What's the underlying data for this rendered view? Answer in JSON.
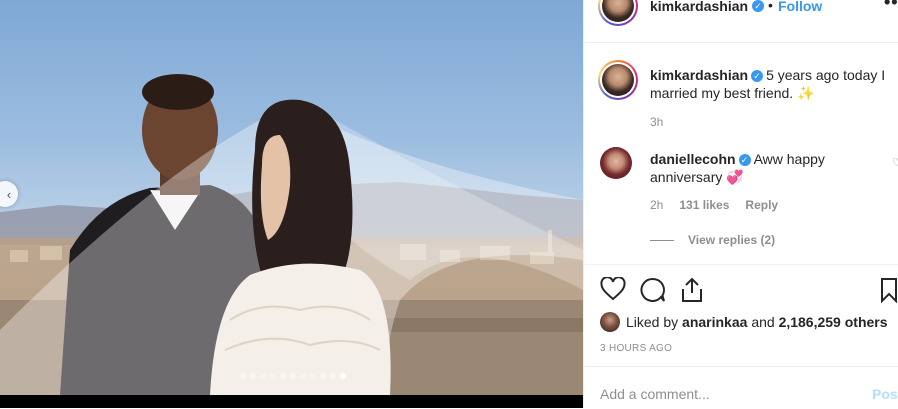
{
  "header": {
    "username": "kimkardashian",
    "separator": "•",
    "follow_label": "Follow",
    "more_label": "••"
  },
  "caption": {
    "username": "kimkardashian",
    "text": "5 years ago today I married my best friend.",
    "emoji": "✨",
    "time": "3h"
  },
  "comment": {
    "username": "daniellecohn",
    "text": "Aww happy anniversary",
    "emoji": "💞",
    "time": "2h",
    "likes": "131 likes",
    "reply_label": "Reply",
    "heart_icon": "heart-outline-icon",
    "heart_glyph": "♡"
  },
  "view_replies": "View replies (2)",
  "likes": {
    "prefix": "Liked by",
    "user": "anarinkaa",
    "and": "and",
    "count": "2,186,259 others"
  },
  "time_ago": "3 HOURS AGO",
  "add_comment": {
    "placeholder": "Add a comment...",
    "post_label": "Post"
  },
  "carousel": {
    "prev_glyph": "‹",
    "dot_count": 11,
    "active_index": 10
  },
  "colors": {
    "accent": "#3897f0",
    "post_disabled": "#b2dffc",
    "muted": "#8e8e8e"
  }
}
